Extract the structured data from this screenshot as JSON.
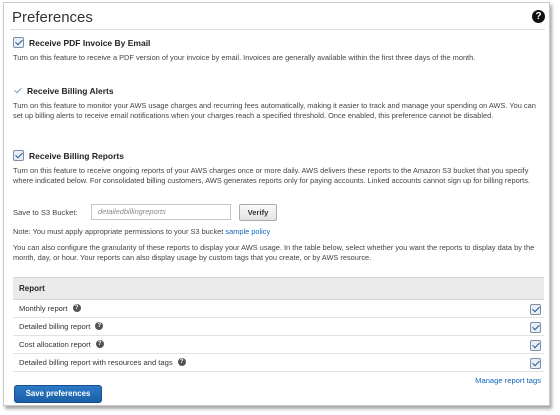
{
  "page": {
    "title": "Preferences",
    "help_icon_glyph": "?"
  },
  "pdf_invoice": {
    "label": "Receive PDF Invoice By Email",
    "checked": true,
    "description": "Turn on this feature to receive a PDF version of your invoice by email. Invoices are generally available within the first three days of the month."
  },
  "billing_alerts": {
    "label": "Receive Billing Alerts",
    "checked": true,
    "description": "Turn on this feature to monitor your AWS usage charges and recurring fees automatically, making it easier to track and manage your spending on AWS. You can set up billing alerts to receive email notifications when your charges reach a specified threshold. Once enabled, this preference cannot be disabled."
  },
  "billing_reports": {
    "label": "Receive Billing Reports",
    "checked": true,
    "description": "Turn on this feature to receive ongoing reports of your AWS charges once or more daily. AWS delivers these reports to the Amazon S3 bucket that you specify where indicated below. For consolidated billing customers, AWS generates reports only for paying accounts. Linked accounts cannot sign up for billing reports."
  },
  "s3": {
    "label": "Save to S3 Bucket:",
    "value": "detailedbillingreports",
    "verify_label": "Verify"
  },
  "note": {
    "text": "Note: You must apply appropriate permissions to your S3 bucket",
    "link": "sample policy"
  },
  "granularity_text": "You can also configure the granularity of these reports to display your AWS usage. In the table below, select whether you want the reports to display data by the month, day, or hour. Your reports can also display usage by custom tags that you create, or by AWS resource.",
  "report_table": {
    "header": "Report",
    "rows": [
      {
        "label": "Monthly report",
        "checked": true
      },
      {
        "label": "Detailed billing report",
        "checked": true
      },
      {
        "label": "Cost allocation report",
        "checked": true
      },
      {
        "label": "Detailed billing report with resources and tags",
        "checked": true
      }
    ]
  },
  "manage_link": "Manage report tags",
  "save_button": "Save preferences",
  "colors": {
    "primary": "#1a5ea6",
    "link": "#1166bb",
    "table_header": "#eaeaea"
  }
}
